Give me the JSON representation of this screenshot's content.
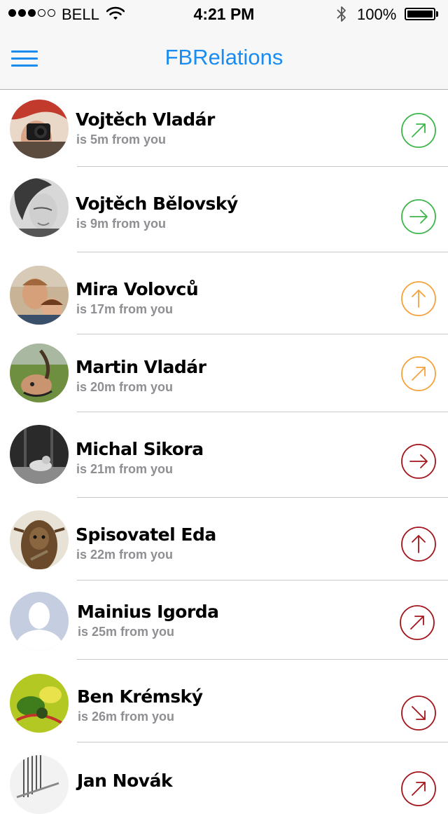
{
  "status_bar": {
    "signal": {
      "filled": 3,
      "empty": 2
    },
    "carrier": "BELL",
    "time": "4:21 PM",
    "battery": "100%",
    "icons": [
      "signal-dots-icon",
      "wifi-icon",
      "bluetooth-icon",
      "battery-icon"
    ]
  },
  "nav": {
    "title": "FBRelations",
    "menu_icon": "hamburger-menu-icon"
  },
  "colors": {
    "accent": "#1a8cf0",
    "near": "#3cb54a",
    "medium": "#f5a23c",
    "far": "#a3141b"
  },
  "contacts": [
    {
      "name": "Vojtěch Vladár",
      "distance": "is 5m from you",
      "direction": "up-right",
      "proximity": "near",
      "avatar": "photo-camera-selfie"
    },
    {
      "name": "Vojtěch Bělovský",
      "distance": "is 9m from you",
      "direction": "right",
      "proximity": "near",
      "avatar": "photo-bw-portrait"
    },
    {
      "name": "Mira Volovců",
      "distance": "is 17m from you",
      "direction": "up",
      "proximity": "medium",
      "avatar": "photo-couple"
    },
    {
      "name": "Martin Vladár",
      "distance": "is 20m from you",
      "direction": "up-right",
      "proximity": "medium",
      "avatar": "photo-outdoor"
    },
    {
      "name": "Michal Sikora",
      "distance": "is 21m from you",
      "direction": "right",
      "proximity": "far",
      "avatar": "photo-bw-dance"
    },
    {
      "name": "Spisovatel Eda",
      "distance": "is 22m from you",
      "direction": "up",
      "proximity": "far",
      "avatar": "photo-wookiee"
    },
    {
      "name": "Mainius Igorda",
      "distance": "is 25m from you",
      "direction": "up-right",
      "proximity": "far",
      "avatar": "default-silhouette"
    },
    {
      "name": "Ben Krémský",
      "distance": "is 26m from you",
      "direction": "down-right",
      "proximity": "far",
      "avatar": "photo-green-yellow"
    },
    {
      "name": "Jan Novák",
      "distance": "",
      "direction": "up-right",
      "proximity": "far",
      "avatar": "photo-sketch"
    }
  ]
}
